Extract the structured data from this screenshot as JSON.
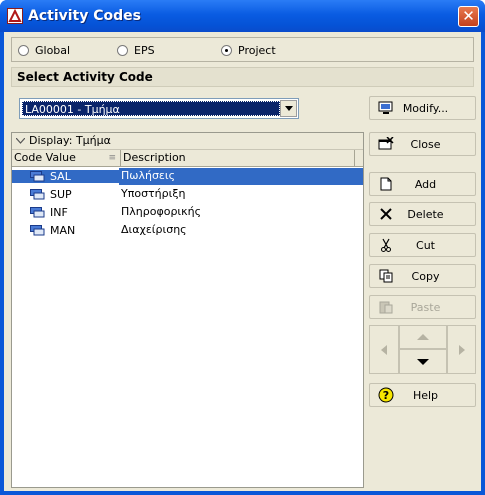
{
  "window": {
    "title": "Activity Codes"
  },
  "scope": {
    "options": [
      "Global",
      "EPS",
      "Project"
    ],
    "selected": "Project"
  },
  "select_section": {
    "title": "Select Activity Code"
  },
  "code_combo": {
    "value": "LA00001 - Τμήμα"
  },
  "buttons": {
    "modify": "Modify...",
    "close": "Close",
    "add": "Add",
    "delete": "Delete",
    "cut": "Cut",
    "copy": "Copy",
    "paste": "Paste",
    "help": "Help"
  },
  "grid": {
    "display_label": "Display: Τμήμα",
    "columns": [
      "Code Value",
      "Description"
    ],
    "rows": [
      {
        "code": "SAL",
        "description": "Πωλήσεις",
        "selected": true
      },
      {
        "code": "SUP",
        "description": "Υποστήριξη",
        "selected": false
      },
      {
        "code": "INF",
        "description": "Πληροφορικής",
        "selected": false
      },
      {
        "code": "MAN",
        "description": "Διαχείρισης",
        "selected": false
      }
    ]
  },
  "colors": {
    "titlebar": "#0a5ce2",
    "selection": "#316ac5",
    "dialog": "#ece9d8"
  }
}
